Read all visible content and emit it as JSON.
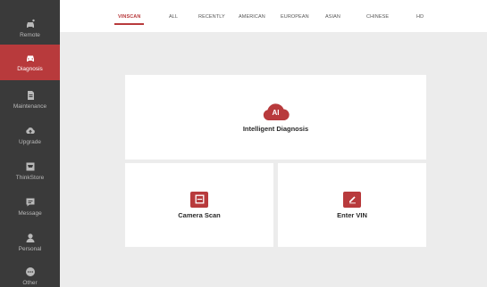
{
  "sidebar": {
    "items": [
      {
        "label": "Remote",
        "icon": "car-remote-icon",
        "active": false
      },
      {
        "label": "Diagnosis",
        "icon": "car-icon",
        "active": true
      },
      {
        "label": "Maintenance",
        "icon": "wrench-icon",
        "active": false
      },
      {
        "label": "Upgrade",
        "icon": "cloud-upload-icon",
        "active": false
      },
      {
        "label": "ThinkStore",
        "icon": "store-icon",
        "active": false
      },
      {
        "label": "Message",
        "icon": "message-icon",
        "active": false
      },
      {
        "label": "Personal",
        "icon": "person-icon",
        "active": false
      },
      {
        "label": "Other",
        "icon": "more-icon",
        "active": false
      }
    ]
  },
  "tabs": [
    {
      "label": "VINSCAN",
      "active": true
    },
    {
      "label": "ALL",
      "active": false
    },
    {
      "label": "RECENTLY",
      "active": false
    },
    {
      "label": "AMERICAN",
      "active": false
    },
    {
      "label": "EUROPEAN",
      "active": false
    },
    {
      "label": "ASIAN",
      "active": false
    },
    {
      "label": "CHINESE",
      "active": false
    },
    {
      "label": "HD",
      "active": false
    }
  ],
  "cards": {
    "intelligent": {
      "badge": "AI",
      "label": "Intelligent Diagnosis"
    },
    "camera": {
      "label": "Camera Scan"
    },
    "vin": {
      "label": "Enter VIN"
    }
  },
  "colors": {
    "accent": "#b83a3c",
    "sidebar": "#3a3a3a",
    "background": "#ececec"
  }
}
